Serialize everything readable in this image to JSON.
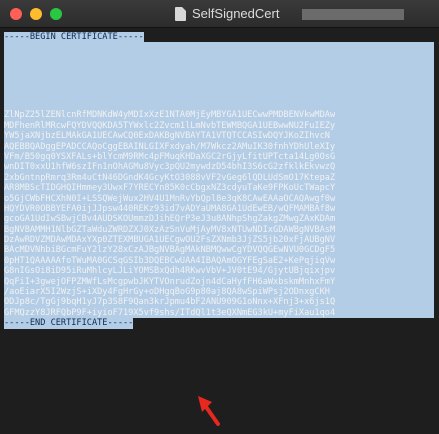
{
  "window": {
    "title": "SelfSignedCert",
    "traffic_lights": [
      "close",
      "minimize",
      "maximize"
    ]
  },
  "certificate": {
    "begin": "-----BEGIN CERTIFICATE-----",
    "lines": [
      "ZlNpZ25lZENlcnRfMDNKdW4yMDIxXzE1NTA0MjEyMBYGA1UECwwPMDBENVkwMDAw",
      "MDFhenRlMRcwFQYDVQQKDA5TYWxlc2Zvcm1lLmNvbTEWMBQGA1UEBwwNU2FuIEZy",
      "YW5jaXNjbzELMAkGA1UECAwCQ0ExDAKBgNVBAYTA1VTQTCCASIwDQYJKoZIhvcN",
      "AQEBBQADggEPADCCAQoCggEBAINLGIXFxdyah/M7Wkcz2AMuIK30fnhYDhUleXIy",
      "VFm/B50gq0YSXFALs+blYcmM9RMc4pFMuqKHDaXGC2rGjyLfitUPTcta14Lg0OsG",
      "wnDIT0xxU1hfW6szIFn1nOhAGMu8Vyc3pQU2mywdzD54bhI3S6cG2zfklkEkvwzQ",
      "2xbGntnpRmrq3Rm4uCtN46DGndK4GcyKtO3088vVF2vGeg6lQDLUdSmO17KtepaZ",
      "AR8MBScTIDGHQIHmmey3UwxF7YRECYn85K0cCbgxNZ3cdyuTaKe9FPKoUcTWapcY",
      "o5GjCWbFHCXhN0I+LSSQWejWux2HV4U1MnRvYbQpl8e3qK8CAwEAAaOCAQAwgf0w",
      "HQYDVR0OBBYEFA0ijJJpsw440REKz93id7vADYaUMA8GA1UdEwEB/wQFMAMBAf8w",
      "gcoGA1UdIwSBwjCBv4AUDSKOUmmzDJihEQrP3eJ3u8ANhpShgZakgZMwgZAxKDAm",
      "BgNVBAMMH1NlbGZTaWduZWRDZXJ0XzAzSnVuMjAyMV8xNTUwNDIxGDAWBgNVBAsM",
      "DzAwRDVZMDAwMDAxYXp0ZTEXMBUGA1UECgwOU2FsZXNmb3JjZS5jb20xFjAUBgNV",
      "BAcMDVNhbiBGcmFuY2lzY28xCzAJBgNVBAgMAkNBMQwwCgYDVQQGEwNVU0GCDgF5",
      "0pHT1QAAAAAfoTWuMA0GCSqGSIb3DQEBCwUAA4IBAQAmOGYFEgSaE2+KePqjiqVw",
      "G8nIGsOi8iD95iRuMhlcyLJLiYOMSBxQdh4RKwvVbV+JV0tE94/GjytUBjqixjpv",
      "QqFiI+3gwejOFPZMWfLsMcgpwbJKYTVOnrudZojn4dCaHyfFH6aWxbskmMnhxFmY",
      "/aoEiarX5I2WzjS+iXDy4FgHrGy+oDHgqBoG9p80aj8QA8wSpiWPsj2ODnxgCKH",
      "ODJp8c/TgGj9bqH1yJ7p3S8F9Qan3krJpmu4bF2ANU909G1oNnx+XFnj3+x6js1Q",
      "GFMQzzY8JRFQbP9F+iyioF719X5vf9shs/ITdQl1t3eQXNmEG3kU+myFiXau1qo4"
    ],
    "end": "-----END CERTIFICATE-----"
  },
  "colors": {
    "selection": "#b3cde6",
    "selection_text": "#0c2a52",
    "arrow": "#e8281f",
    "background": "#1e1e1e"
  }
}
